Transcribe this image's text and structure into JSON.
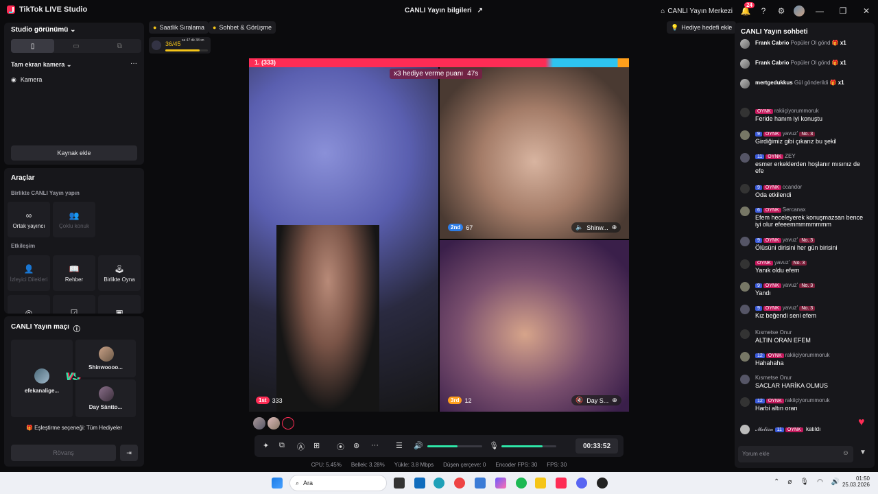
{
  "app": {
    "title": "TikTok LIVE Studio",
    "stream_info": "CANLI Yayın bilgileri",
    "center": "CANLI Yayın Merkezi",
    "notif_count": "24"
  },
  "left": {
    "studio_view": "Studio görünümü",
    "fullscreen_camera": "Tam ekran kamera",
    "camera": "Kamera",
    "add_source": "Kaynak ekle",
    "tools_title": "Araçlar",
    "together_live": "Birlikte CANLI Yayın yapın",
    "co_host": "Ortak yayıncı",
    "multi_guest": "Çoklu konuk",
    "interaction": "Etkileşim",
    "viewer_requests": "İzleyici Dilekleri",
    "guide": "Rehber",
    "play_together": "Birlikte Oyna",
    "match_title": "CANLI Yayın maçı",
    "player1": "efekanalige...",
    "player2": "Shinwoooo...",
    "player3": "Day Säntto...",
    "vs": "VS",
    "match_option": "Eşleştirme seçeneği: Tüm Hediyeler",
    "rematch": "Rövanş"
  },
  "topbar": {
    "hourly": "Saatlik Sıralama",
    "chat_meet": "Sohbet & Görüşme",
    "gift_goal": "Hediye hedefi ekle",
    "progress": "36/45",
    "progress_value": 0.8,
    "timer_small": "sa 47 dk 38 sn"
  },
  "stage": {
    "rank_banner": "1. (333)",
    "multiplier": "x3 hediye verme puanı",
    "multiplier_time": "47s",
    "p1_rank": "1st",
    "p1_score": "333",
    "p2_rank": "2nd",
    "p2_score": "67",
    "p2_name": "Shinw...",
    "p3_rank": "3rd",
    "p3_score": "12",
    "p3_name": "Day S..."
  },
  "controls": {
    "timer": "00:33:52",
    "volume_value": 0.55,
    "mic_value": 0.75
  },
  "stats": {
    "cpu": "CPU: 5.45%",
    "memory": "Bellek: 3.28%",
    "upload": "Yükle: 3.8 Mbps",
    "dropped": "Düşen çerçeve: 0",
    "encoder": "Encoder FPS: 30",
    "fps": "FPS: 30"
  },
  "chat": {
    "title": "CANLI Yayın sohbeti",
    "gifts": [
      {
        "user": "Frank Cabrio",
        "text": "Popüler Ol gönd",
        "count": "x1"
      },
      {
        "user": "Frank Cabrio",
        "text": "Popüler Ol gönd",
        "count": "x1"
      },
      {
        "user": "mertgedukkus",
        "text": "Gül gönderildi",
        "count": "x1"
      }
    ],
    "messages": [
      {
        "lvl": "",
        "oy": "OYNK",
        "user": "rakiiçiyorummoruk",
        "no": "",
        "text": "Feride hanım iyi konuştu"
      },
      {
        "lvl": "9",
        "oy": "OYNK",
        "user": "yavuz'",
        "no": "No. 3",
        "text": "Girdiğimiz gibi çıkarız bu şekil"
      },
      {
        "lvl": "11",
        "oy": "OYNK",
        "user": "ZEY",
        "no": "",
        "text": "esmer erkeklerden hoşlanır mısınız de efe"
      },
      {
        "lvl": "9",
        "oy": "OYNK",
        "user": "ccandor",
        "no": "",
        "text": "Oda etkilendi"
      },
      {
        "lvl": "6",
        "oy": "OYNK",
        "user": "Sercanax",
        "no": "",
        "text": "Efem heceleyerek konuşmazsan bence iyi olur efeeemmmmmmmm"
      },
      {
        "lvl": "9",
        "oy": "OYNK",
        "user": "yavuz'",
        "no": "No. 3",
        "text": "Ölüsüni dirisini her gün birisini"
      },
      {
        "lvl": "",
        "oy": "OYNK",
        "user": "yavuz'",
        "no": "No. 3",
        "text": "Yanık oldu efem"
      },
      {
        "lvl": "9",
        "oy": "OYNK",
        "user": "yavuz'",
        "no": "No. 3",
        "text": "Yandı"
      },
      {
        "lvl": "9",
        "oy": "OYNK",
        "user": "yavuz'",
        "no": "No. 3",
        "text": "Kız beğendi seni efem"
      },
      {
        "lvl": "",
        "oy": "",
        "user": "Kısmetse Onur",
        "no": "",
        "text": "ALTIN ORAN EFEM"
      },
      {
        "lvl": "12",
        "oy": "OYNK",
        "user": "rakiiçiyorummoruk",
        "no": "",
        "text": "Hahahaha"
      },
      {
        "lvl": "",
        "oy": "",
        "user": "Kısmetse Onur",
        "no": "",
        "text": "SACLAR HARİKA OLMUS"
      },
      {
        "lvl": "12",
        "oy": "OYNK",
        "user": "rakiiçiyorummoruk",
        "no": "",
        "text": "Harbi altın oran"
      }
    ],
    "join": {
      "user": "𝓜𝓮𝓵𝓲𝓼𝓪",
      "lvl": "11",
      "oy": "OYNK",
      "text": "katıldı"
    },
    "input_placeholder": "Yorum ekle"
  },
  "taskbar": {
    "search": "Ara",
    "time": "01:50",
    "date": "25.03.2026"
  }
}
